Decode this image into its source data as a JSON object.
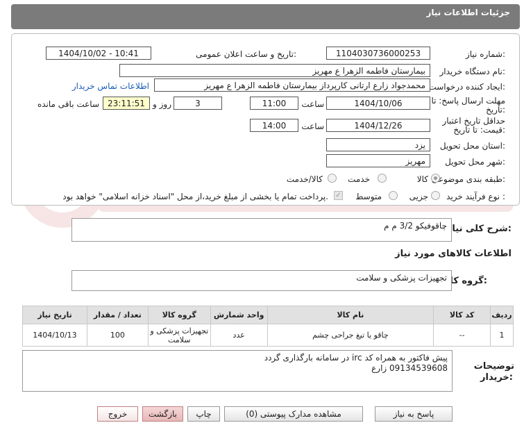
{
  "header": {
    "title": "جزئیات اطلاعات نیاز"
  },
  "form": {
    "need_number": {
      "label": "شماره نیاز:",
      "value": "1104030736000253"
    },
    "announce": {
      "label": "تاریخ و ساعت اعلان عمومی:",
      "value": "1404/10/02 - 10:41"
    },
    "buyer_org": {
      "label": "نام دستگاه خریدار:",
      "value": "بیمارستان فاطمه الزهرا ع  مهریز"
    },
    "requester": {
      "label": "ایجاد کننده درخواست:",
      "value": "محمدجواد زارع ارتانی کارپرداز بیمارستان فاطمه الزهرا ع  مهریز",
      "contact_link": "اطلاعات تماس خریدار"
    },
    "reply_deadline": {
      "label1": "مهلت ارسال پاسخ: تا",
      "label2": "تاریخ:",
      "date": "1404/10/06",
      "time_label": "ساعت",
      "time": "11:00",
      "days": "3",
      "days_label": "روز و",
      "remaining": "23:11:51",
      "remaining_label": "ساعت باقی مانده"
    },
    "price_validity": {
      "label1": "حداقل تاریخ اعتبار",
      "label2": "قیمت: تا تاریخ:",
      "date": "1404/12/26",
      "time_label": "ساعت",
      "time": "14:00"
    },
    "province": {
      "label": "استان محل تحویل:",
      "value": "یزد"
    },
    "city": {
      "label": "شهر محل تحویل:",
      "value": "مهریز"
    },
    "category": {
      "label": "طبقه بندی موضوعی:",
      "options": [
        "کالا",
        "خدمت",
        "کالا/خدمت"
      ],
      "selected": "کالا"
    },
    "process": {
      "label": "نوع فرآیند خرید :",
      "options": [
        "جزیی",
        "متوسط"
      ],
      "payment_note": "پرداخت تمام یا بخشی از مبلغ خرید،از محل \"اسناد خزانه اسلامی\" خواهد بود."
    }
  },
  "summary": {
    "label": "شرح کلی نیاز:",
    "value": "چاقوفیکو 3/2 م م"
  },
  "goods_info": {
    "title": "اطلاعات کالاهای مورد نیاز"
  },
  "goods_group": {
    "label": "گروه کالا:",
    "value": "تجهیزات پزشکی و سلامت"
  },
  "table": {
    "headers": [
      "ردیف",
      "کد کالا",
      "نام کالا",
      "واحد شمارش",
      "گروه کالا",
      "تعداد / مقدار",
      "تاریخ نیاز"
    ],
    "rows": [
      [
        "1",
        "--",
        "چاقو یا تیغ جراحی چشم",
        "عدد",
        "تجهیزات پزشکی و سلامت",
        "100",
        "1404/10/13"
      ]
    ]
  },
  "buyer_notes": {
    "label1": "توضیحات",
    "label2": "خریدار:",
    "line1": "پیش فاکتور به همراه کد irc در سامانه بارگذاری گردد",
    "line2": "09134539608 زارع"
  },
  "buttons": {
    "reply": "پاسخ به نیاز",
    "attachments": "مشاهده مدارک پیوستی (0)",
    "print": "چاپ",
    "back": "بازگشت",
    "exit": "خروج"
  }
}
